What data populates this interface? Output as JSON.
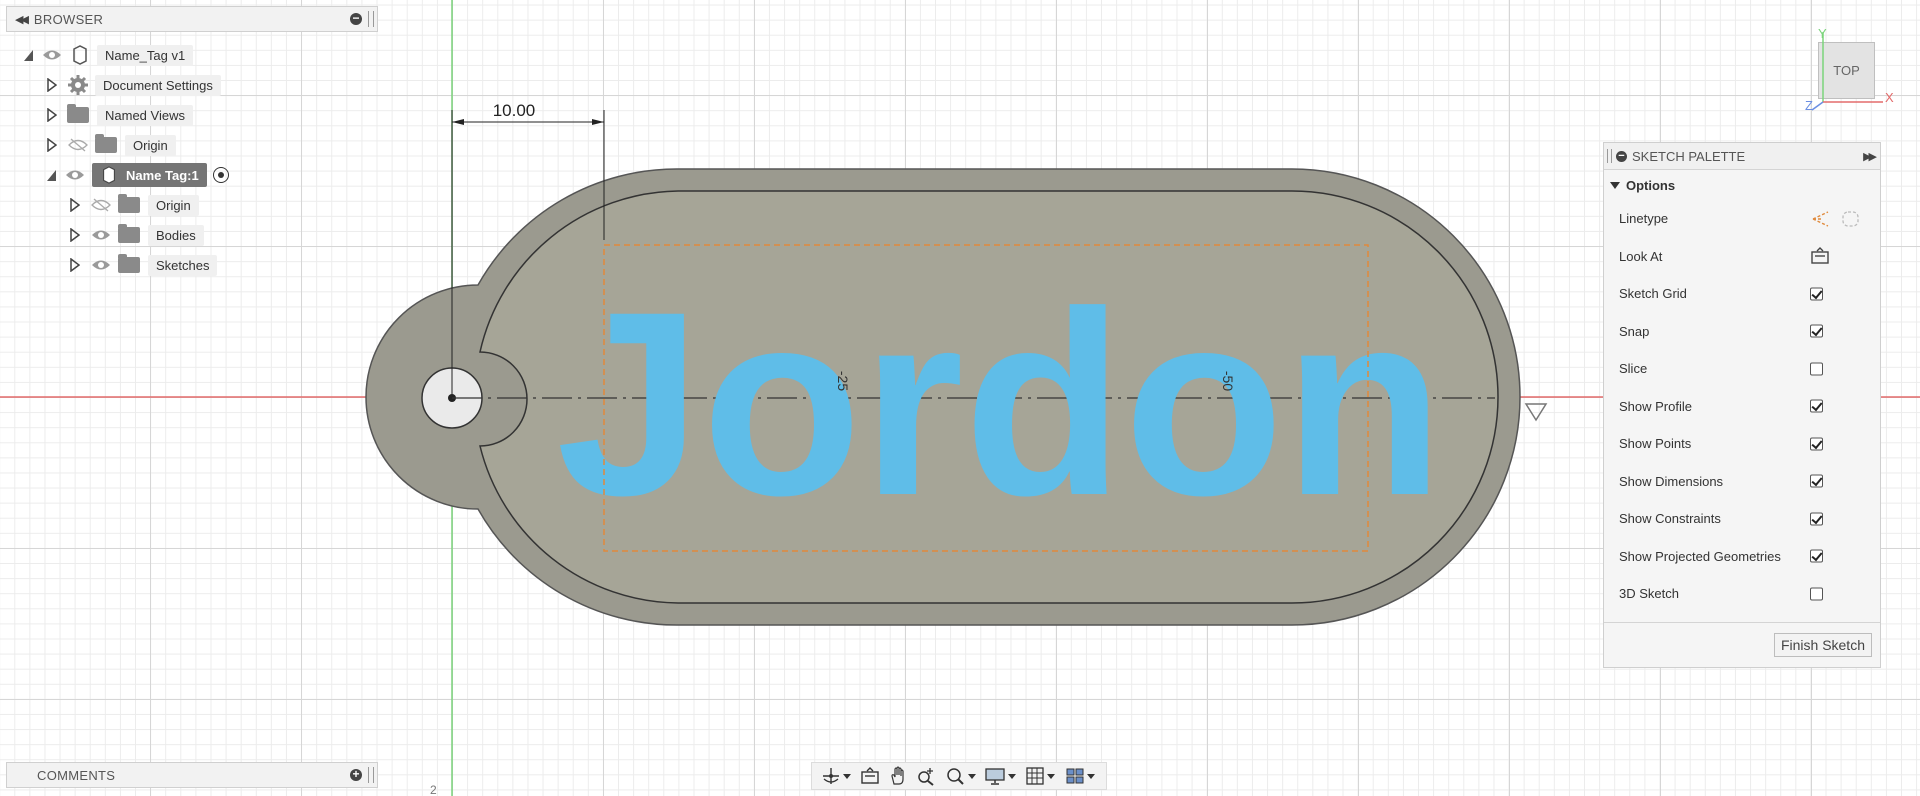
{
  "browser": {
    "title": "BROWSER",
    "items": [
      {
        "label": "Name_Tag v1",
        "icon": "component-icon"
      },
      {
        "label": "Document Settings",
        "icon": "gear-icon"
      },
      {
        "label": "Named Views",
        "icon": "folder-icon"
      },
      {
        "label": "Origin",
        "icon": "folder-icon",
        "visible": false
      },
      {
        "label": "Name Tag:1",
        "icon": "component-icon",
        "selected": true
      },
      {
        "label": "Origin",
        "icon": "folder-icon",
        "visible": false
      },
      {
        "label": "Bodies",
        "icon": "folder-icon",
        "visible": true
      },
      {
        "label": "Sketches",
        "icon": "folder-icon",
        "visible": true
      }
    ]
  },
  "comments": {
    "title": "COMMENTS"
  },
  "canvas": {
    "text": "Jordon",
    "dimension": "10.00",
    "ruler_labels": [
      "-25",
      "-50"
    ],
    "corner_label": "2",
    "colors": {
      "body": "#9b9a8f",
      "text": "#5fbde8",
      "profile": "#e08a3c",
      "red_axis": "#e36b6b",
      "green_axis": "#7bd47b"
    }
  },
  "viewcube": {
    "face": "TOP",
    "axis_y": "Y",
    "axis_x": "X",
    "axis_z": "Z"
  },
  "palette": {
    "title": "SKETCH PALETTE",
    "section": "Options",
    "rows": [
      {
        "label": "Linetype",
        "type": "icons"
      },
      {
        "label": "Look At",
        "type": "icon"
      },
      {
        "label": "Sketch Grid",
        "checked": true
      },
      {
        "label": "Snap",
        "checked": true
      },
      {
        "label": "Slice",
        "checked": false
      },
      {
        "label": "Show Profile",
        "checked": true
      },
      {
        "label": "Show Points",
        "checked": true
      },
      {
        "label": "Show Dimensions",
        "checked": true
      },
      {
        "label": "Show Constraints",
        "checked": true
      },
      {
        "label": "Show Projected Geometries",
        "checked": true
      },
      {
        "label": "3D Sketch",
        "checked": false
      }
    ],
    "finish": "Finish Sketch"
  }
}
